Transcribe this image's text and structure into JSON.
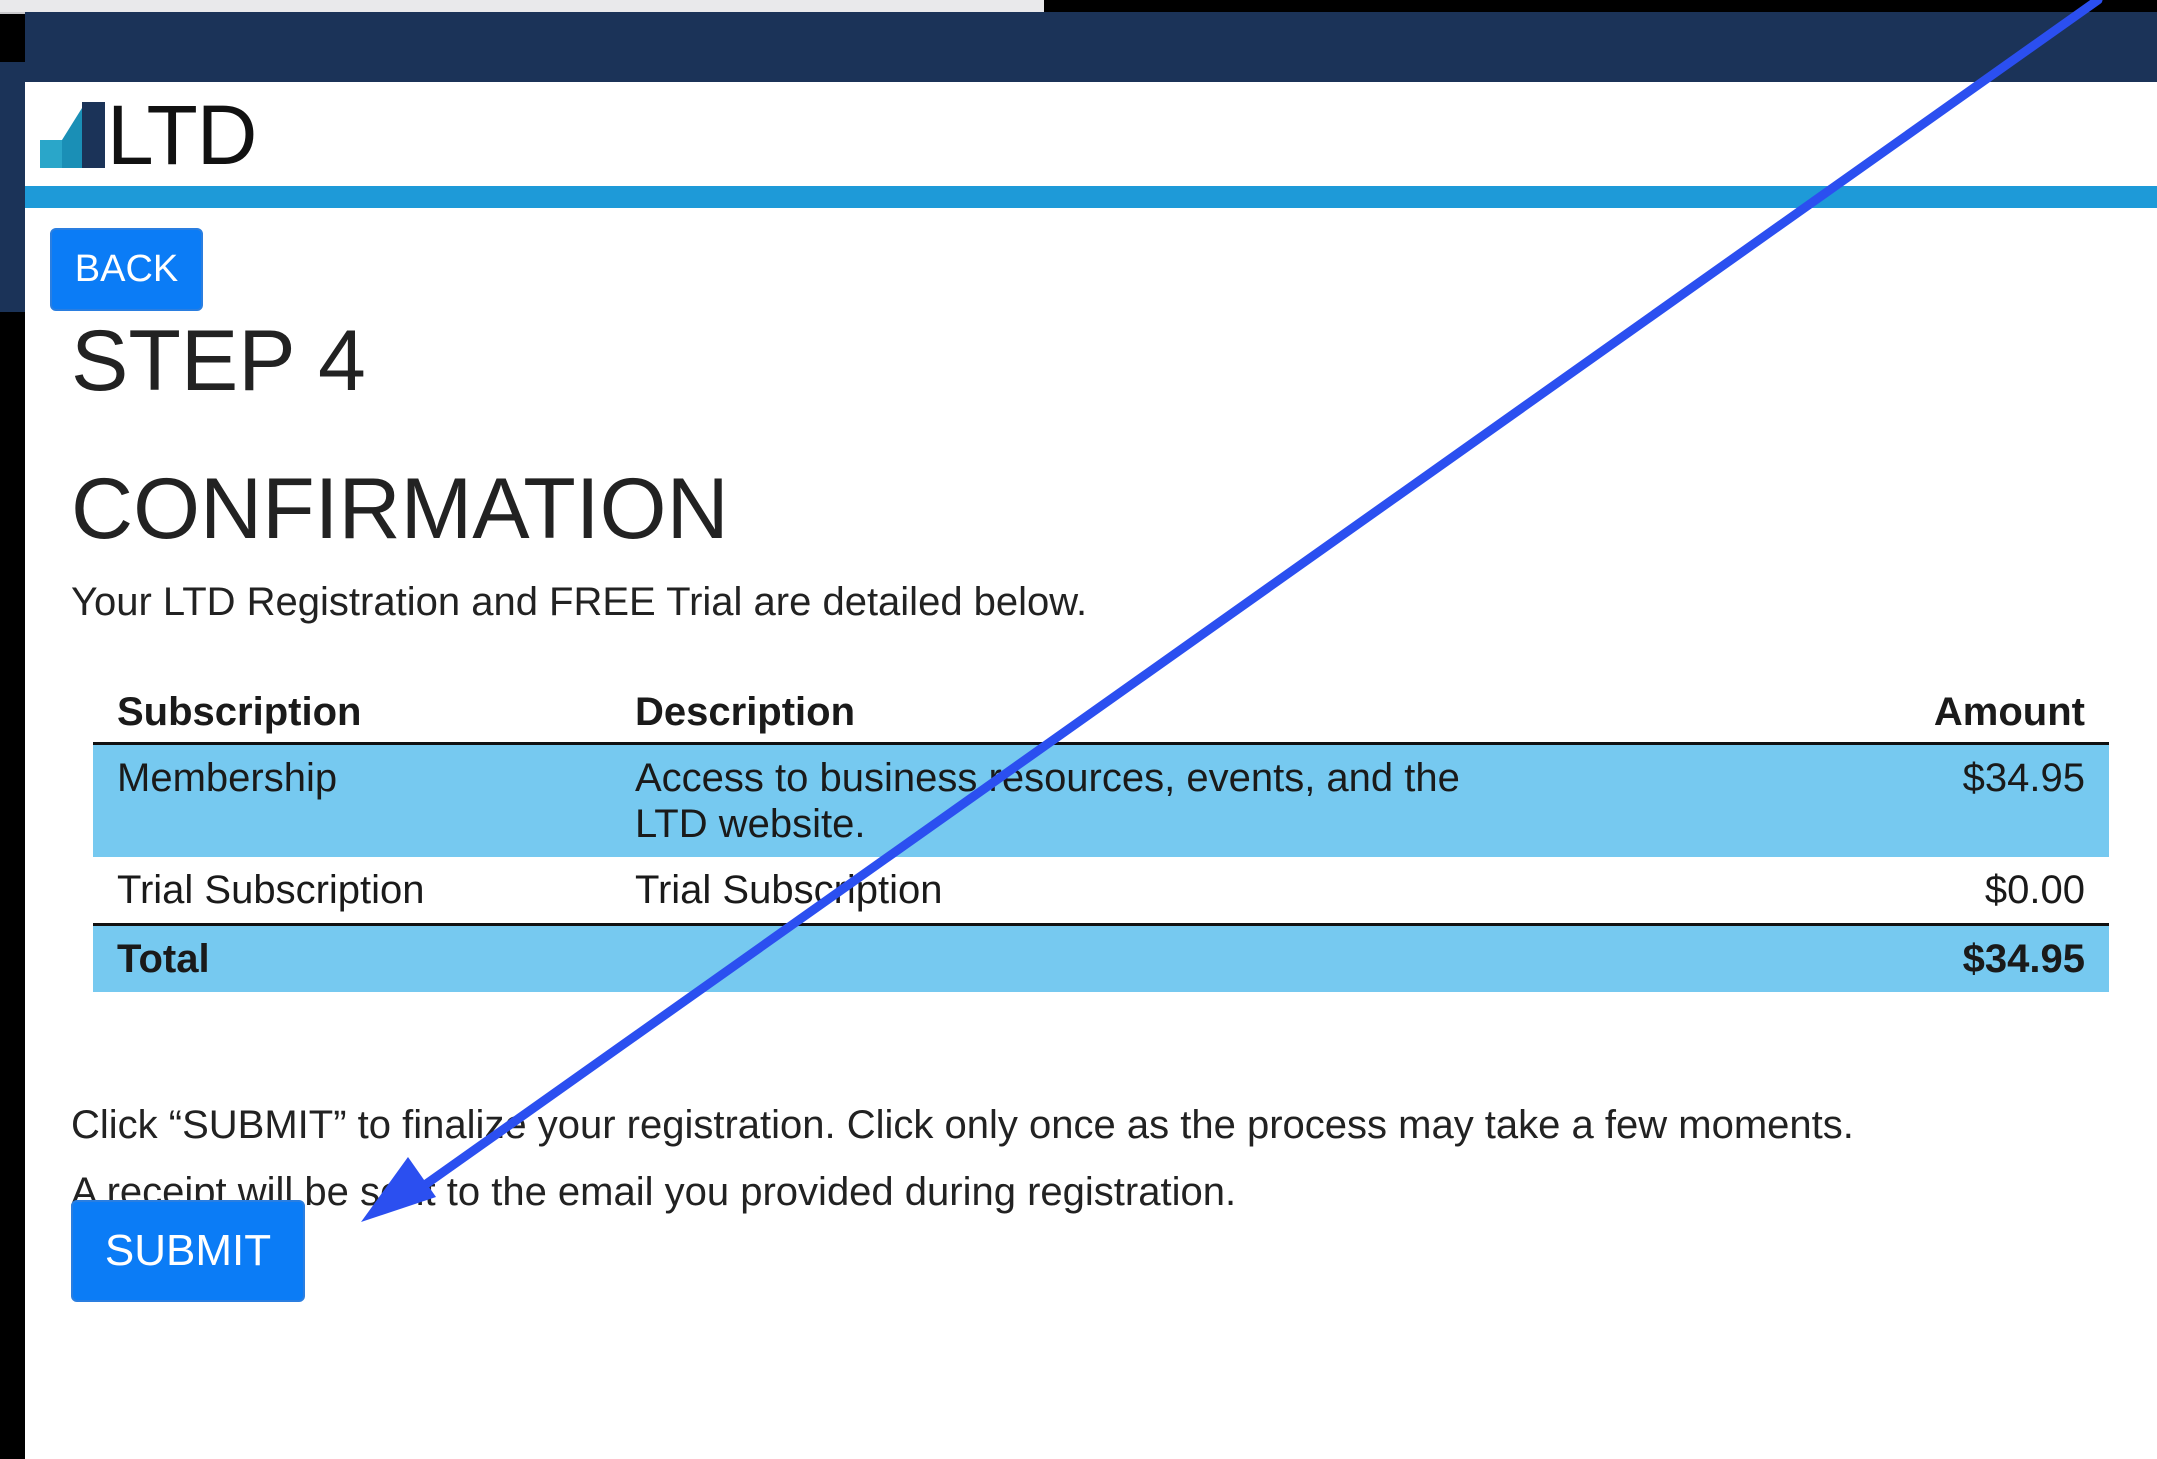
{
  "header": {
    "logo_text": "LTD"
  },
  "navigation": {
    "back_label": "BACK"
  },
  "main": {
    "step_title": "STEP 4",
    "section_title": "CONFIRMATION",
    "intro_text": "Your LTD Registration and FREE Trial are detailed below."
  },
  "summary_table": {
    "columns": [
      "Subscription",
      "Description",
      "Amount"
    ],
    "rows": [
      {
        "subscription": "Membership",
        "description": "Access to business resources, events, and the LTD website.",
        "amount": "$34.95"
      },
      {
        "subscription": "Trial Subscription",
        "description": "Trial Subscription",
        "amount": "$0.00"
      }
    ],
    "total": {
      "label": "Total",
      "amount": "$34.95"
    }
  },
  "instructions": {
    "line1": "Click “SUBMIT” to finalize your registration. Click only once as the process may take a few moments.",
    "line2": "A receipt will be sent to the email you provided during registration."
  },
  "actions": {
    "submit_label": "SUBMIT"
  },
  "colors": {
    "header_navy": "#1b3358",
    "accent_blue": "#1e9ad8",
    "button_blue": "#0b7cf6",
    "row_highlight": "#76c9f0",
    "annotation_arrow": "#2b4ff0"
  }
}
